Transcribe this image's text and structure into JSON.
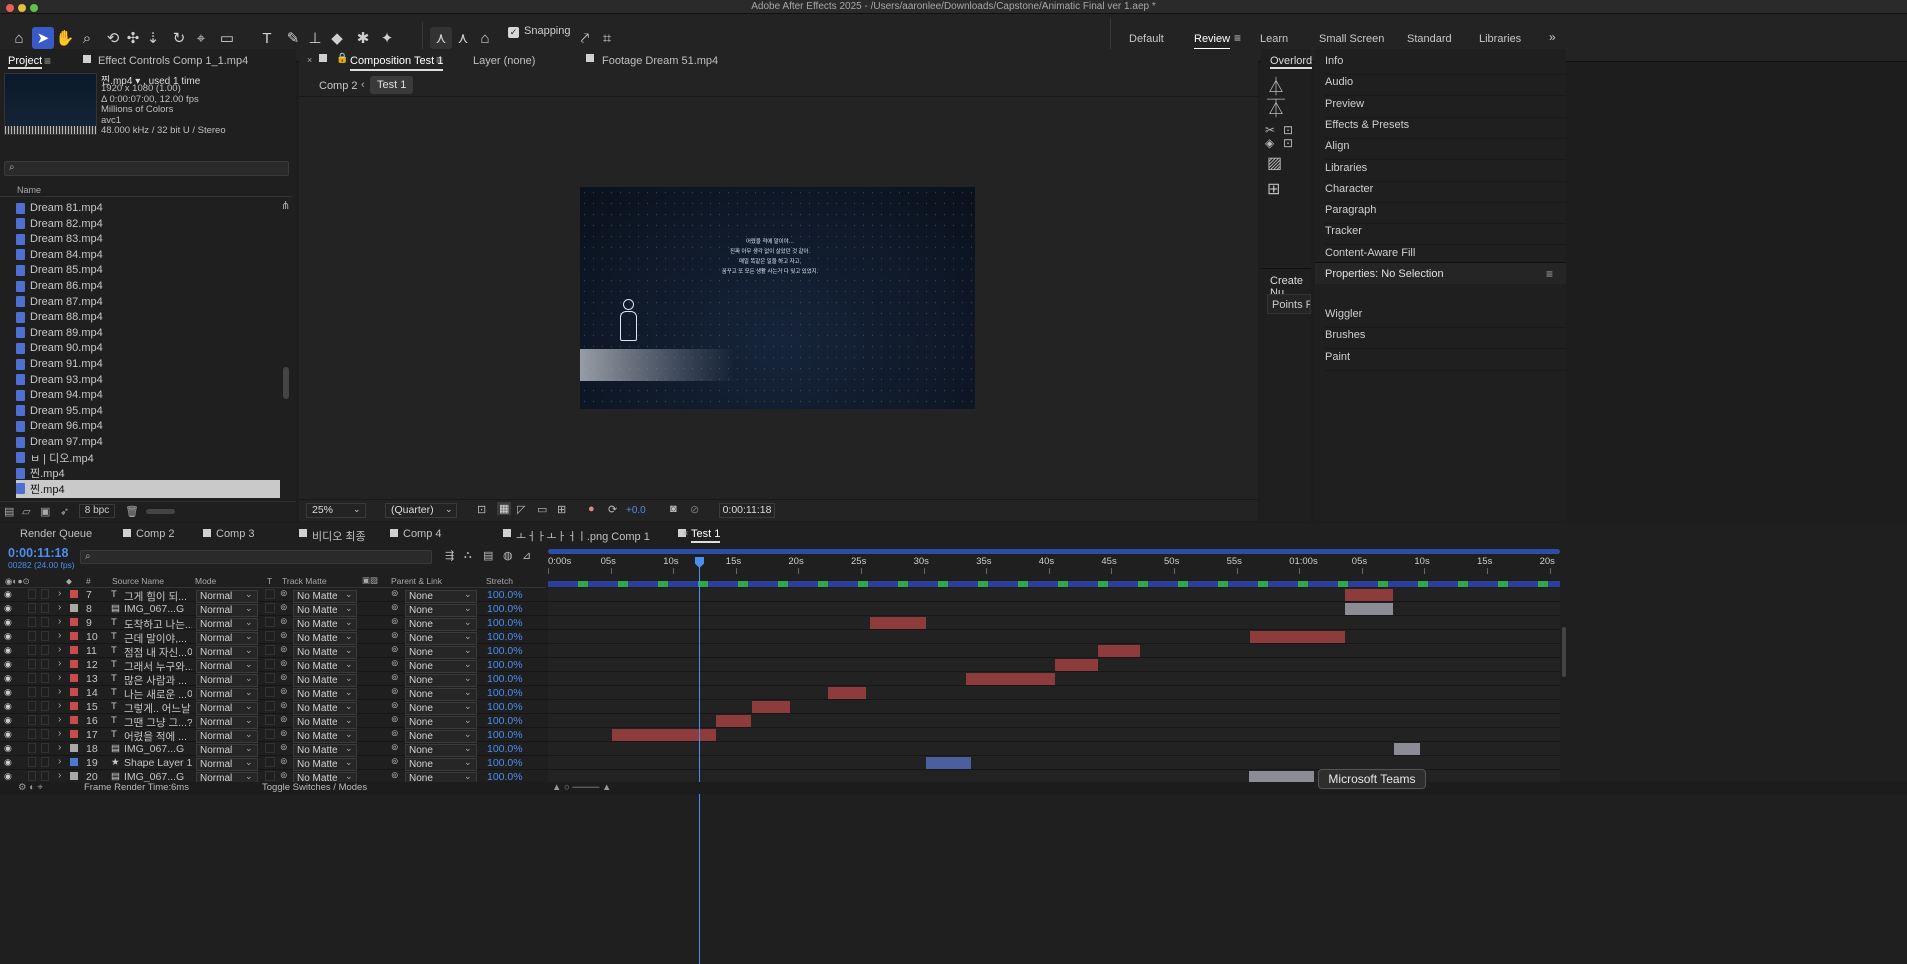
{
  "window": {
    "title": "Adobe After Effects 2025 - /Users/aaronlee/Downloads/Capstone/Animatic Final ver 1.aep *"
  },
  "toolbar": {
    "snapping_label": "Snapping",
    "tools": [
      "home-icon",
      "selection-tool-icon",
      "hand-tool-icon",
      "zoom-tool-icon",
      "orbit-camera-icon",
      "pan-camera-icon",
      "dolly-camera-icon",
      "rotation-tool-icon",
      "pan-behind-icon",
      "rectangle-tool-icon",
      "type-tool-icon",
      "pen-tool-icon",
      "brush-tool-icon",
      "clone-stamp-icon",
      "eraser-tool-icon",
      "roto-brush-icon",
      "puppet-tool-icon"
    ]
  },
  "workspaces": [
    "Default",
    "Review",
    "Learn",
    "Small Screen",
    "Standard",
    "Libraries"
  ],
  "workspace_active": "Review",
  "project_panel": {
    "tab_project": "Project",
    "tab_effects": "Effect Controls Comp 1_1.mp4",
    "info_name": "찐.mp4 ▾ , used 1 time",
    "info_lines": [
      "1920 x 1080 (1.00)",
      "Δ 0:00:07:00, 12.00 fps",
      "Millions of Colors",
      "avc1",
      "48.000 kHz / 32 bit U / Stereo"
    ],
    "search_placeholder": "",
    "column_name": "Name",
    "items": [
      "Dream 81.mp4",
      "Dream 82.mp4",
      "Dream 83.mp4",
      "Dream 84.mp4",
      "Dream 85.mp4",
      "Dream 86.mp4",
      "Dream 87.mp4",
      "Dream 88.mp4",
      "Dream 89.mp4",
      "Dream 90.mp4",
      "Dream 91.mp4",
      "Dream 93.mp4",
      "Dream 94.mp4",
      "Dream 95.mp4",
      "Dream 96.mp4",
      "Dream 97.mp4",
      "ㅂ | 디오.mp4",
      "찐.mp4",
      "찐.mp4"
    ],
    "bpc": "8 bpc"
  },
  "viewer": {
    "tab_comp": "Composition Test 1",
    "tab_layer": "Layer (none)",
    "tab_footage": "Footage Dream 51.mp4",
    "breadcrumb_parent": "Comp 2",
    "breadcrumb_current": "Test 1",
    "subtitle_lines": [
      "어렸을 적에 말이야…",
      "진짜 아무 생각 없이 살았던 것 같아.",
      "매일 똑같은 일을 하고 자고,",
      "꿈꾸고 또 모든 생활 사는거 다 잊고 있었지."
    ],
    "zoom": "25%",
    "resolution": "(Quarter)",
    "exposure": "+0.0",
    "timecode": "0:00:11:18"
  },
  "tools_panel": {
    "title": "Overlord",
    "create_label": "Create Nu",
    "points_label": "Points F"
  },
  "right_panel": {
    "items": [
      "Info",
      "Audio",
      "Preview",
      "Effects & Presets",
      "Align",
      "Libraries",
      "Character",
      "Paragraph",
      "Tracker",
      "Content-Aware Fill"
    ],
    "properties": "Properties: No Selection",
    "items2": [
      "Wiggler",
      "Brushes",
      "Paint"
    ]
  },
  "timeline": {
    "tabs": [
      "Render Queue",
      "Comp 2",
      "Comp 3",
      "비디오 최종",
      "Comp 4",
      "ㅗㅓㅏㅗㅏㅓㅣ.png Comp 1",
      "Test 1"
    ],
    "active_tab": "Test 1",
    "timecode": "0:00:11:18",
    "frame_info": "00282 (24.00 fps)",
    "columns": {
      "num": "#",
      "source": "Source Name",
      "mode": "Mode",
      "t": "T",
      "matte": "Track Matte",
      "parent": "Parent & Link",
      "stretch": "Stretch"
    },
    "ruler": [
      "0:00s",
      "05s",
      "10s",
      "15s",
      "20s",
      "25s",
      "30s",
      "35s",
      "40s",
      "45s",
      "50s",
      "55s",
      "01:00s",
      "05s",
      "10s",
      "15s",
      "20s"
    ],
    "layers": [
      {
        "num": "7",
        "type": "T",
        "name": "그게 힘이 되...",
        "mode": "Normal",
        "matte": "No Matte",
        "parent": "None",
        "stretch": "100.0%",
        "color": "#c84c4c"
      },
      {
        "num": "8",
        "type": "img",
        "name": "IMG_067...G",
        "mode": "Normal",
        "matte": "No Matte",
        "parent": "None",
        "stretch": "100.0%",
        "color": "#a8a8a8"
      },
      {
        "num": "9",
        "type": "T",
        "name": "도착하고 나는...",
        "mode": "Normal",
        "matte": "No Matte",
        "parent": "None",
        "stretch": "100.0%",
        "color": "#c84c4c"
      },
      {
        "num": "10",
        "type": "T",
        "name": "근데 말이야,...",
        "mode": "Normal",
        "matte": "No Matte",
        "parent": "None",
        "stretch": "100.0%",
        "color": "#c84c4c"
      },
      {
        "num": "11",
        "type": "T",
        "name": "점점 내 자신...어",
        "mode": "Normal",
        "matte": "No Matte",
        "parent": "None",
        "stretch": "100.0%",
        "color": "#c84c4c"
      },
      {
        "num": "12",
        "type": "T",
        "name": "그래서 누구와...",
        "mode": "Normal",
        "matte": "No Matte",
        "parent": "None",
        "stretch": "100.0%",
        "color": "#c84c4c"
      },
      {
        "num": "13",
        "type": "T",
        "name": "많은 사람과 ...",
        "mode": "Normal",
        "matte": "No Matte",
        "parent": "None",
        "stretch": "100.0%",
        "color": "#c84c4c"
      },
      {
        "num": "14",
        "type": "T",
        "name": "나는 새로운 ...어",
        "mode": "Normal",
        "matte": "No Matte",
        "parent": "None",
        "stretch": "100.0%",
        "color": "#c84c4c"
      },
      {
        "num": "15",
        "type": "T",
        "name": "그렇게.. 어느날",
        "mode": "Normal",
        "matte": "No Matte",
        "parent": "None",
        "stretch": "100.0%",
        "color": "#c84c4c"
      },
      {
        "num": "16",
        "type": "T",
        "name": "그땐 그냥 그...?",
        "mode": "Normal",
        "matte": "No Matte",
        "parent": "None",
        "stretch": "100.0%",
        "color": "#c84c4c"
      },
      {
        "num": "17",
        "type": "T",
        "name": "어렸을 적에 ...",
        "mode": "Normal",
        "matte": "No Matte",
        "parent": "None",
        "stretch": "100.0%",
        "color": "#c84c4c"
      },
      {
        "num": "18",
        "type": "img",
        "name": "IMG_067...G",
        "mode": "Normal",
        "matte": "No Matte",
        "parent": "None",
        "stretch": "100.0%",
        "color": "#a8a8a8"
      },
      {
        "num": "19",
        "type": "shape",
        "name": "Shape Layer 1",
        "mode": "Normal",
        "matte": "No Matte",
        "parent": "None",
        "stretch": "100.0%",
        "color": "#4a7ad6"
      },
      {
        "num": "20",
        "type": "img",
        "name": "IMG_067...G",
        "mode": "Normal",
        "matte": "No Matte",
        "parent": "None",
        "stretch": "100.0%",
        "color": "#a8a8a8"
      }
    ],
    "bottom_render": "Frame Render Time:",
    "bottom_render_val": "6ms",
    "bottom_toggle": "Toggle Switches / Modes"
  },
  "notification": "Microsoft Teams",
  "colors": {
    "accent": "#3a5bc7",
    "timecode": "#4c8df0",
    "label_red": "#c84c4c"
  }
}
